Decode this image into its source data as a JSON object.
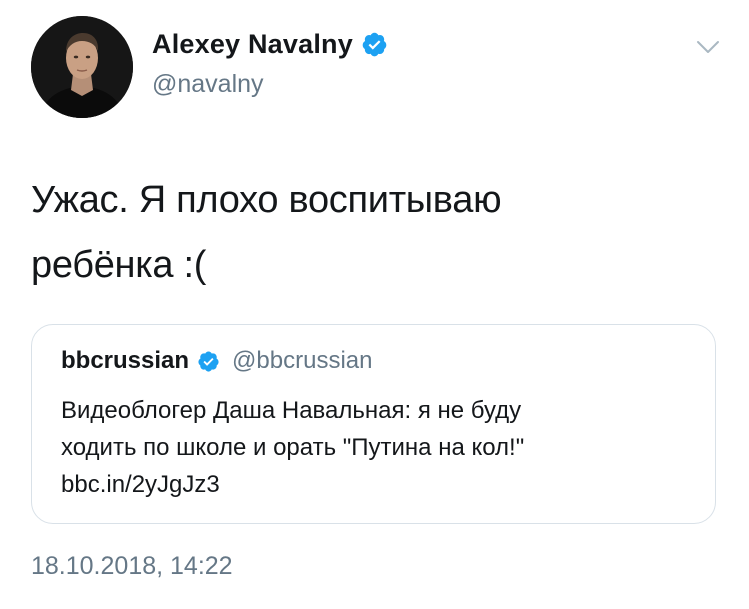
{
  "author": {
    "display_name": "Alexey Navalny",
    "handle": "@navalny",
    "verified": true
  },
  "tweet": {
    "text_line1": "Ужас. Я плохо воспитываю",
    "text_line2": "ребёнка :("
  },
  "quoted_tweet": {
    "display_name": "bbcrussian",
    "handle": "@bbcrussian",
    "verified": true,
    "text_line1": "Видеоблогер Даша Навальная: я не буду",
    "text_line2": "ходить по школе и орать \"Путина на кол!\"",
    "link": "bbc.in/2yJgJz3"
  },
  "timestamp": "18.10.2018, 14:22",
  "icons": {
    "verified": "verified-badge-icon",
    "menu": "chevron-down-icon"
  },
  "colors": {
    "text": "#14171a",
    "secondary": "#657786",
    "verified_blue": "#1da1f2",
    "border": "#d9e1e8"
  }
}
